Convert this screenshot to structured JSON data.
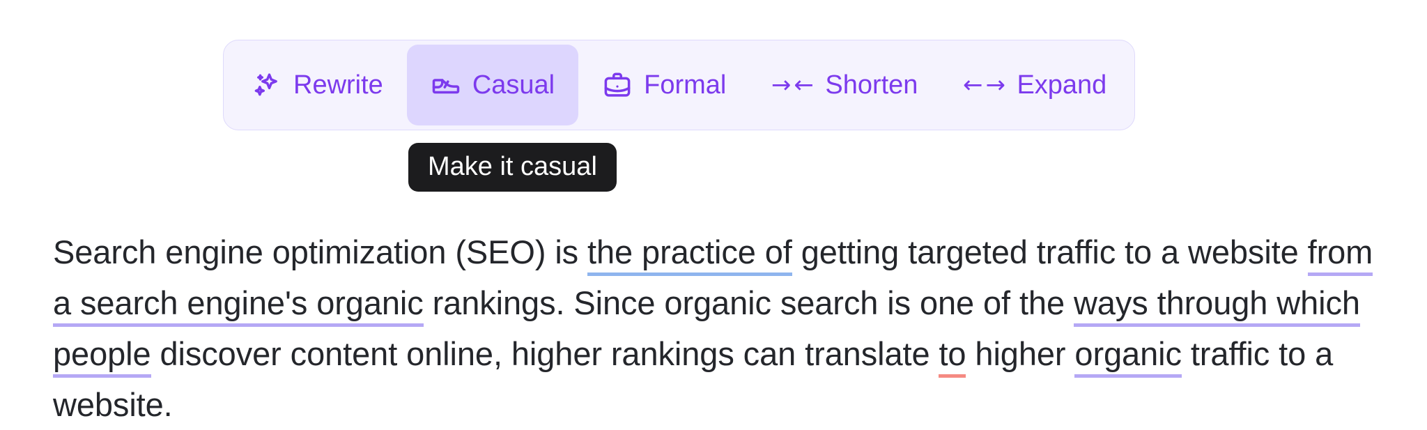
{
  "toolbar": {
    "buttons": [
      {
        "id": "rewrite",
        "label": "Rewrite",
        "icon": "sparkles-icon",
        "active": false
      },
      {
        "id": "casual",
        "label": "Casual",
        "icon": "shoe-icon",
        "active": true
      },
      {
        "id": "formal",
        "label": "Formal",
        "icon": "briefcase-icon",
        "active": false
      },
      {
        "id": "shorten",
        "label": "Shorten",
        "icon": "arrows-in-icon",
        "active": false,
        "glyph": "→←"
      },
      {
        "id": "expand",
        "label": "Expand",
        "icon": "arrows-out-icon",
        "active": false,
        "glyph": "←→"
      }
    ],
    "background_color": "#f5f3fe",
    "border_color": "#ded9fb",
    "accent_color": "#7c3aed",
    "active_background_color": "#ddd6fe"
  },
  "tooltip": {
    "text": "Make it casual",
    "background_color": "#1c1c1e",
    "text_color": "#ffffff"
  },
  "article": {
    "segments": [
      {
        "text": "Search engine optimization (SEO) is ",
        "underline": "none"
      },
      {
        "text": "the practice of",
        "underline": "blue"
      },
      {
        "text": " getting targeted traffic to a website ",
        "underline": "none"
      },
      {
        "text": "from a search engine's organic",
        "underline": "purple"
      },
      {
        "text": " rankings. Since organic search is one of the ",
        "underline": "none"
      },
      {
        "text": "ways through which people",
        "underline": "purple"
      },
      {
        "text": " discover content online, higher rankings can translate ",
        "underline": "none"
      },
      {
        "text": "to",
        "underline": "red"
      },
      {
        "text": " higher ",
        "underline": "none"
      },
      {
        "text": "organic",
        "underline": "purple"
      },
      {
        "text": " traffic to a website.",
        "underline": "none"
      }
    ],
    "underline_colors": {
      "blue": "#8fb5ee",
      "purple": "#b5a8f5",
      "red": "#f58a82"
    },
    "text_color": "#24262b"
  }
}
